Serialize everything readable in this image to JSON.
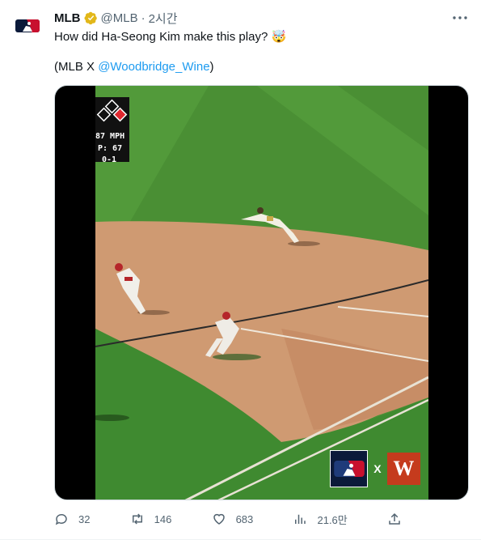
{
  "tweet": {
    "author_name": "MLB",
    "handle": "@MLB",
    "separator": "·",
    "time": "2시간",
    "text_line1": "How did Ha-Seong Kim make this play? 🤯",
    "text_line2_prefix": "(MLB X ",
    "mention": "@Woodbridge_Wine",
    "text_line2_suffix": ")"
  },
  "video": {
    "hud": {
      "speed": "87 MPH",
      "pitch": "P: 67",
      "count": "0-1"
    },
    "logo_separator": "X",
    "brand_letter": "W"
  },
  "actions": {
    "reply_count": "32",
    "retweet_count": "146",
    "like_count": "683",
    "views_count": "21.6만"
  },
  "colors": {
    "link": "#1d9bf0",
    "muted": "#536471",
    "verified": "#e2b719",
    "mlb_navy": "#0b1a3a",
    "mlb_red": "#c8102e",
    "woodbridge": "#c53b1d"
  }
}
